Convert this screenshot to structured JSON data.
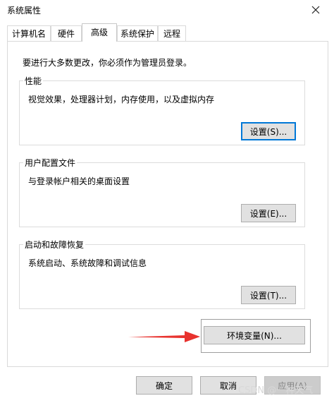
{
  "window": {
    "title": "系统属性",
    "close_icon": "close-icon"
  },
  "tabs": [
    {
      "label": "计算机名",
      "active": false
    },
    {
      "label": "硬件",
      "active": false
    },
    {
      "label": "高级",
      "active": true
    },
    {
      "label": "系统保护",
      "active": false
    },
    {
      "label": "远程",
      "active": false
    }
  ],
  "main": {
    "admin_note": "要进行大多数更改，你必须作为管理员登录。",
    "performance": {
      "title": "性能",
      "description": "视觉效果，处理器计划，内存使用，以及虚拟内存",
      "button": "设置(S)..."
    },
    "user_profiles": {
      "title": "用户配置文件",
      "description": "与登录帐户相关的桌面设置",
      "button": "设置(E)..."
    },
    "startup_recovery": {
      "title": "启动和故障恢复",
      "description": "系统启动、系统故障和调试信息",
      "button": "设置(T)..."
    },
    "env_vars_button": "环境变量(N)..."
  },
  "footer": {
    "ok": "确定",
    "cancel": "取消",
    "apply": "应用(A)"
  },
  "watermark": "CSDN @一种天气",
  "colors": {
    "arrow": "#e8322e",
    "focus_border": "#0078d7"
  }
}
